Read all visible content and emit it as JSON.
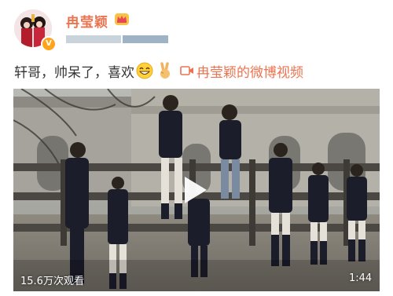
{
  "post": {
    "author": {
      "name": "冉莹颖",
      "verified_badge": "V",
      "badge_icon": "crown-icon"
    },
    "text": "轩哥，帅呆了，喜欢",
    "emojis": [
      "grin-emoji",
      "victory-hand-emoji"
    ],
    "video_link": {
      "icon": "video-camera-icon",
      "label": "冉莹颖的微博视频"
    },
    "video": {
      "view_count": "15.6万次观看",
      "duration": "1:44",
      "play_icon": "play-icon"
    }
  },
  "colors": {
    "link": "#eb7350",
    "text": "#333333",
    "badge": "#ffa31a"
  }
}
